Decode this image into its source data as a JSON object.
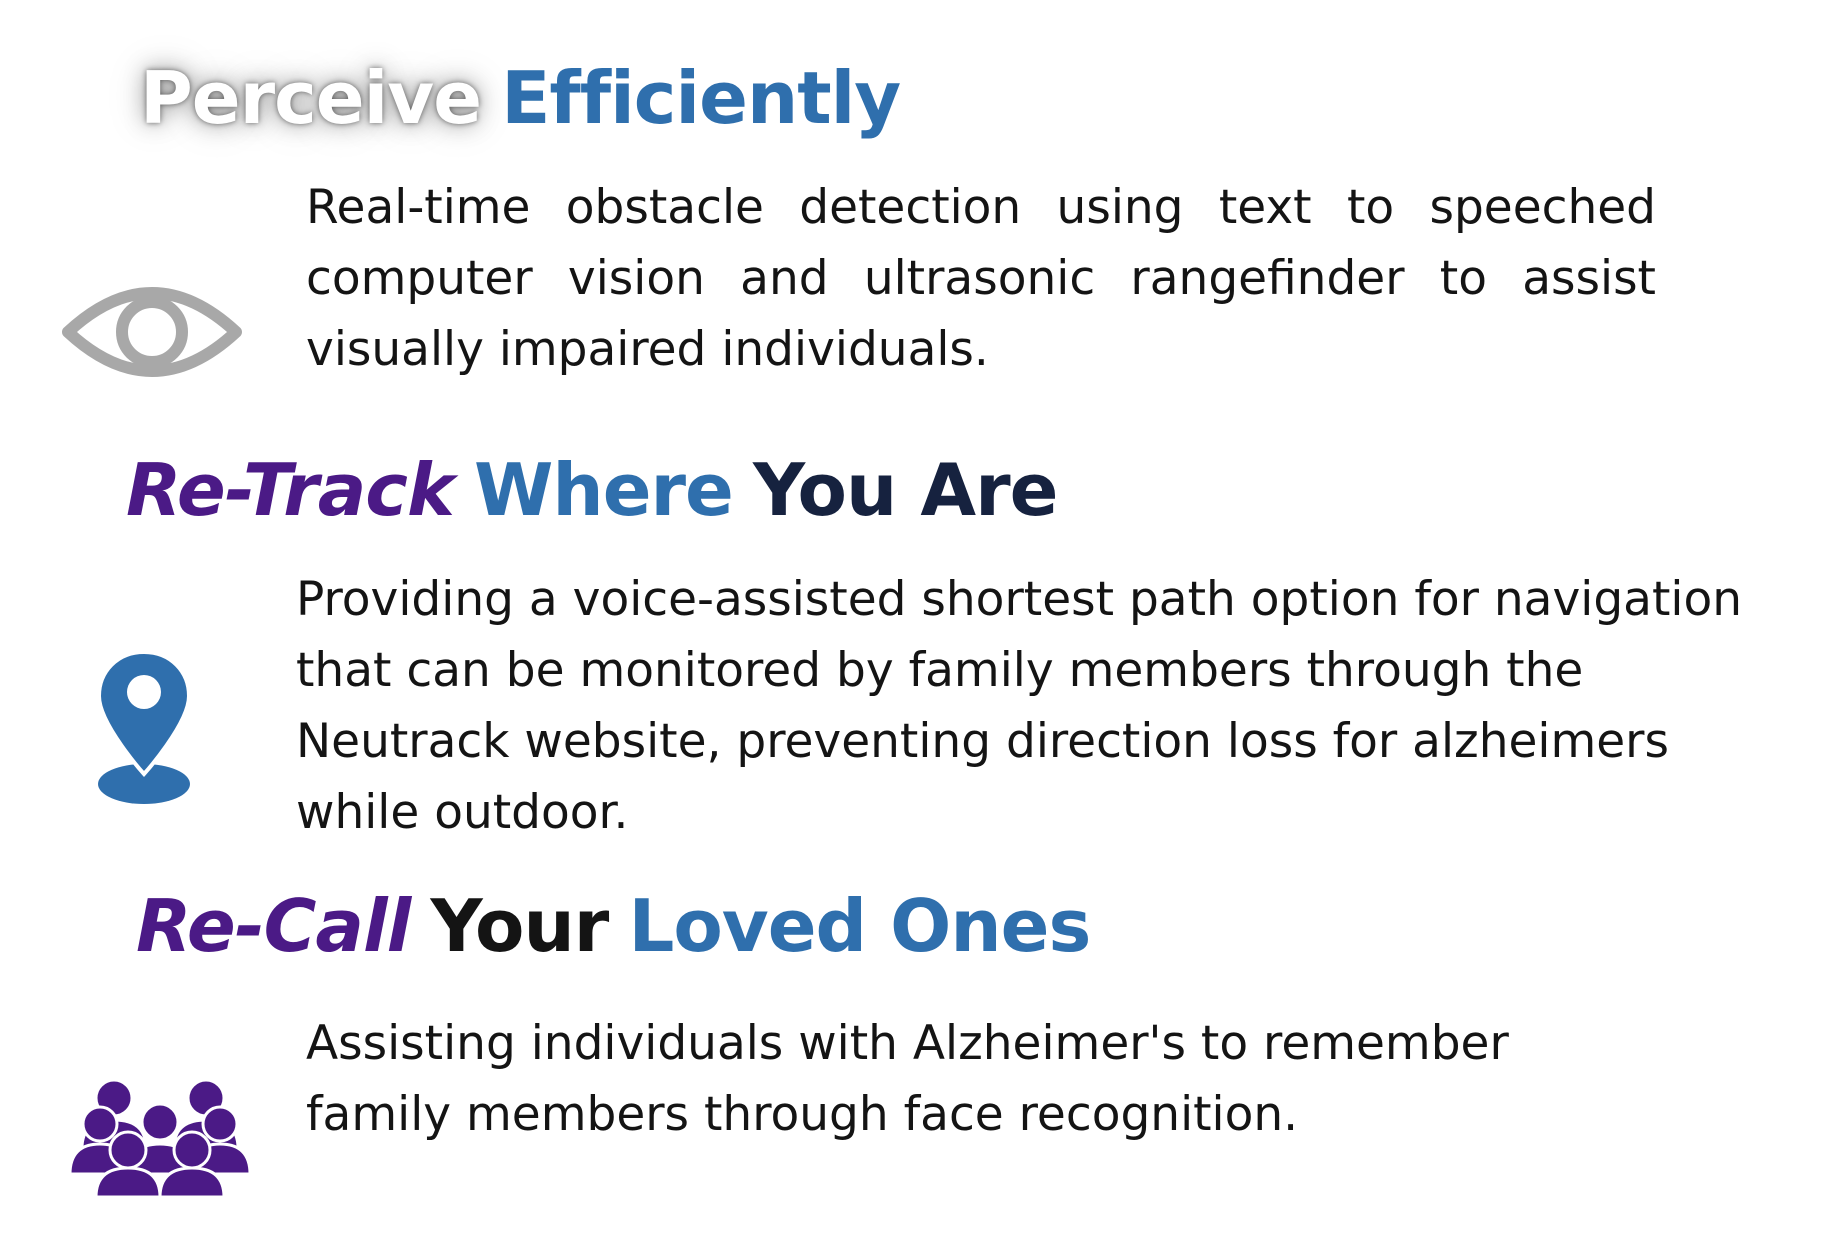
{
  "sections": [
    {
      "heading": {
        "part1": "Perceive",
        "part2": "Efficiently"
      },
      "icon": "eye-icon",
      "icon_color": "#a8a8a8",
      "body": "Real-time obstacle detection using text to speeched computer vision and ultrasonic rangefinder to assist visually impaired individuals."
    },
    {
      "heading": {
        "part1": "Re-Track",
        "part2": "Where",
        "part3": "You Are"
      },
      "icon": "map-pin-icon",
      "icon_color": "#2f6fad",
      "body": "Providing a voice-assisted shortest path option for navigation that can be monitored by family members through the Neutrack website, preventing direction loss for alzheimers while outdoor."
    },
    {
      "heading": {
        "part1": "Re-Call",
        "part2": "Your",
        "part3": "Loved Ones"
      },
      "icon": "people-group-icon",
      "icon_color": "#4b1a86",
      "body": "Assisting individuals with Alzheimer's to remember family members through face recognition."
    }
  ],
  "colors": {
    "blue": "#2f6fad",
    "purple": "#4b1a86",
    "navy": "#16223f",
    "gray": "#a8a8a8"
  }
}
